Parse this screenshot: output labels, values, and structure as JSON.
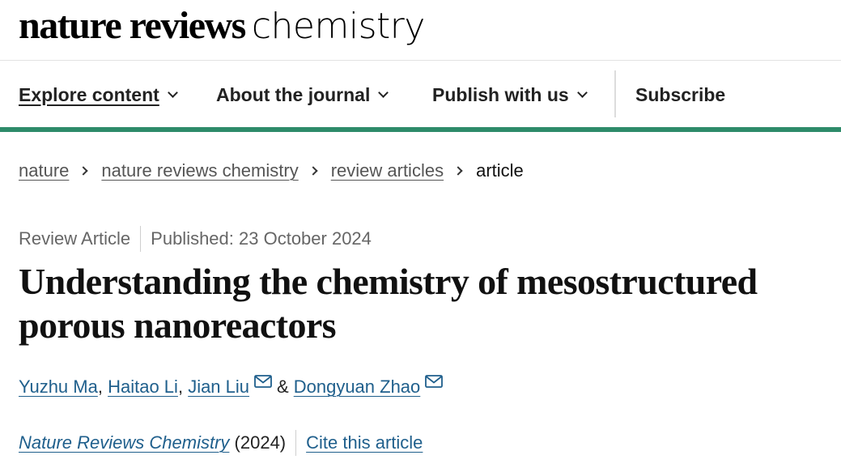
{
  "masthead": {
    "logo_bold": "nature reviews",
    "logo_light": "chemistry"
  },
  "nav": {
    "items": [
      {
        "label": "Explore content",
        "dropdown": true
      },
      {
        "label": "About the journal",
        "dropdown": true
      },
      {
        "label": "Publish with us",
        "dropdown": true
      },
      {
        "label": "Subscribe",
        "dropdown": false
      }
    ],
    "accent_color": "#2e8b6a"
  },
  "breadcrumb": {
    "items": [
      "nature",
      "nature reviews chemistry",
      "review articles"
    ],
    "current": "article"
  },
  "article": {
    "type": "Review Article",
    "published": "Published: 23 October 2024",
    "title": "Understanding the chemistry of mesostructured porous nanoreactors",
    "authors": [
      {
        "name": "Yuzhu Ma",
        "email_icon": false
      },
      {
        "name": "Haitao Li",
        "email_icon": false
      },
      {
        "name": "Jian Liu",
        "email_icon": true
      },
      {
        "name": "Dongyuan Zhao",
        "email_icon": true
      }
    ],
    "separator_comma": ",",
    "separator_amp": "&",
    "journal": "Nature Reviews Chemistry",
    "year": "(2024)",
    "cite_label": "Cite this article",
    "link_color": "#1f5f8c"
  }
}
